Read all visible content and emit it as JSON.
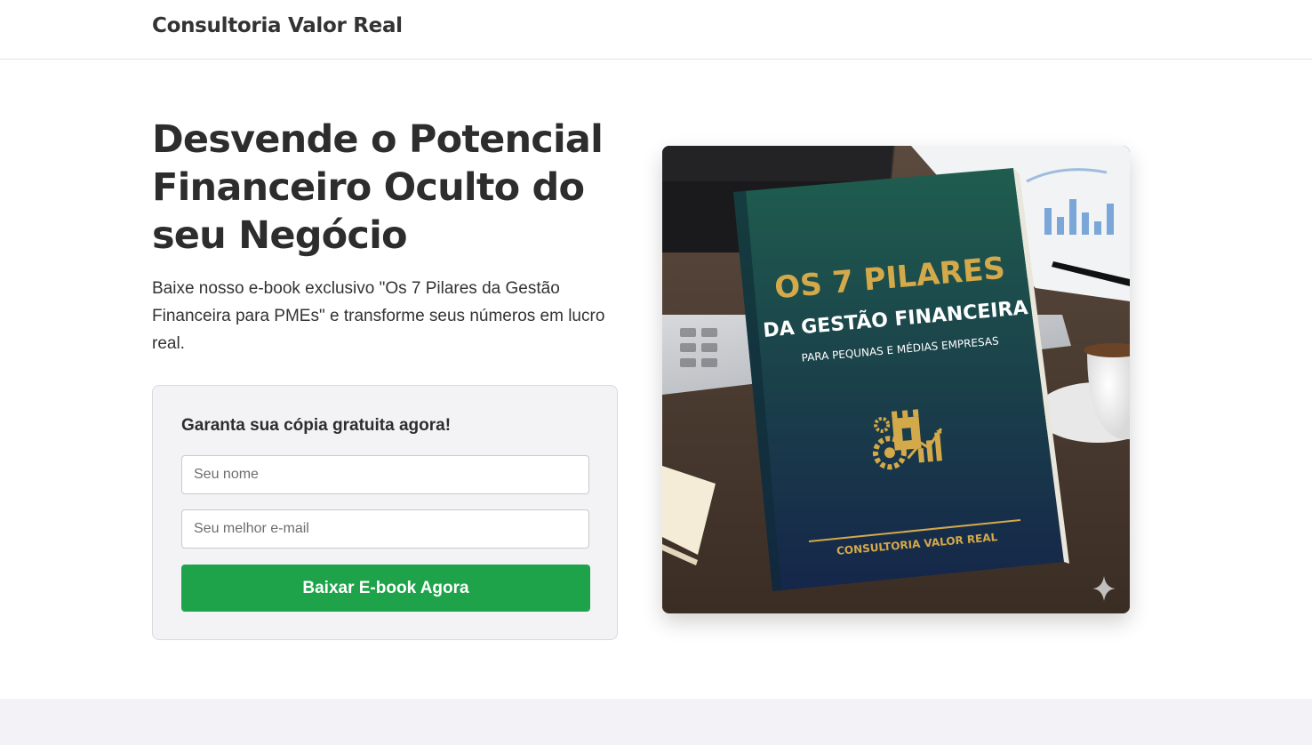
{
  "header": {
    "brand": "Consultoria Valor Real"
  },
  "hero": {
    "title": "Desvende o Potencial Financeiro Oculto do seu Negócio",
    "description": "Baixe nosso e-book exclusivo \"Os 7 Pilares da Gestão Financeira para PMEs\" e transforme seus números em lucro real."
  },
  "form": {
    "heading": "Garanta sua cópia gratuita agora!",
    "name_placeholder": "Seu nome",
    "email_placeholder": "Seu melhor e-mail",
    "submit_label": "Baixar E-book Agora"
  },
  "book": {
    "title_line1": "OS 7 PILARES",
    "title_line2": "DA GESTÃO FINANCEIRA",
    "subtitle": "PARA PEQUNAS E MÉDIAS EMPRESAS",
    "publisher": "CONSULTORIA VALOR REAL"
  },
  "colors": {
    "cta": "#1ea34a",
    "book_cover_top": "#1e5a4c",
    "book_cover_bottom": "#16284a",
    "book_gold": "#d4a94a"
  },
  "icons": [
    "sparkle-icon",
    "castle-gear-chart-icon"
  ]
}
